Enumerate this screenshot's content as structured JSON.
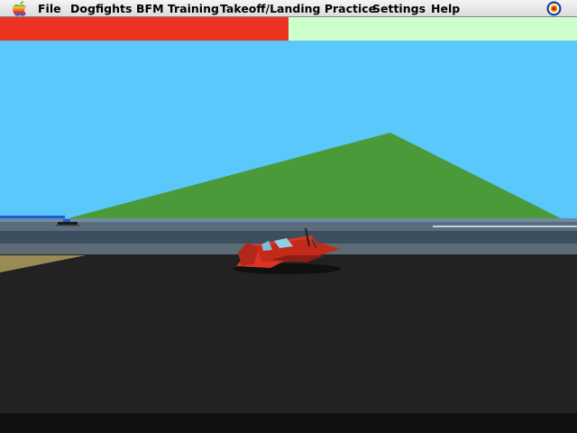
{
  "menu": {
    "apple_icon": "apple-logo-icon",
    "items": [
      {
        "id": "file",
        "label": "File"
      },
      {
        "id": "dogfights",
        "label": "Dogfights"
      },
      {
        "id": "bfm-training",
        "label": "BFM Training"
      },
      {
        "id": "takeoff-landing",
        "label": "Takeoff/Landing Practice"
      },
      {
        "id": "settings",
        "label": "Settings"
      },
      {
        "id": "help",
        "label": "Help"
      }
    ],
    "status_icon": "raf-roundel-icon"
  },
  "status_bar": {
    "fill_fraction": 0.5,
    "fill_color": "#ee3322",
    "empty_color": "#ccffcc"
  },
  "scene": {
    "sky_color": "#5ac8fa",
    "mountain_color": "#4a9a3a",
    "ground_color": "#222222",
    "player_plane_color": "#dd3322",
    "player_plane": "red-propeller-plane",
    "other_aircraft": "distant-aircraft"
  }
}
